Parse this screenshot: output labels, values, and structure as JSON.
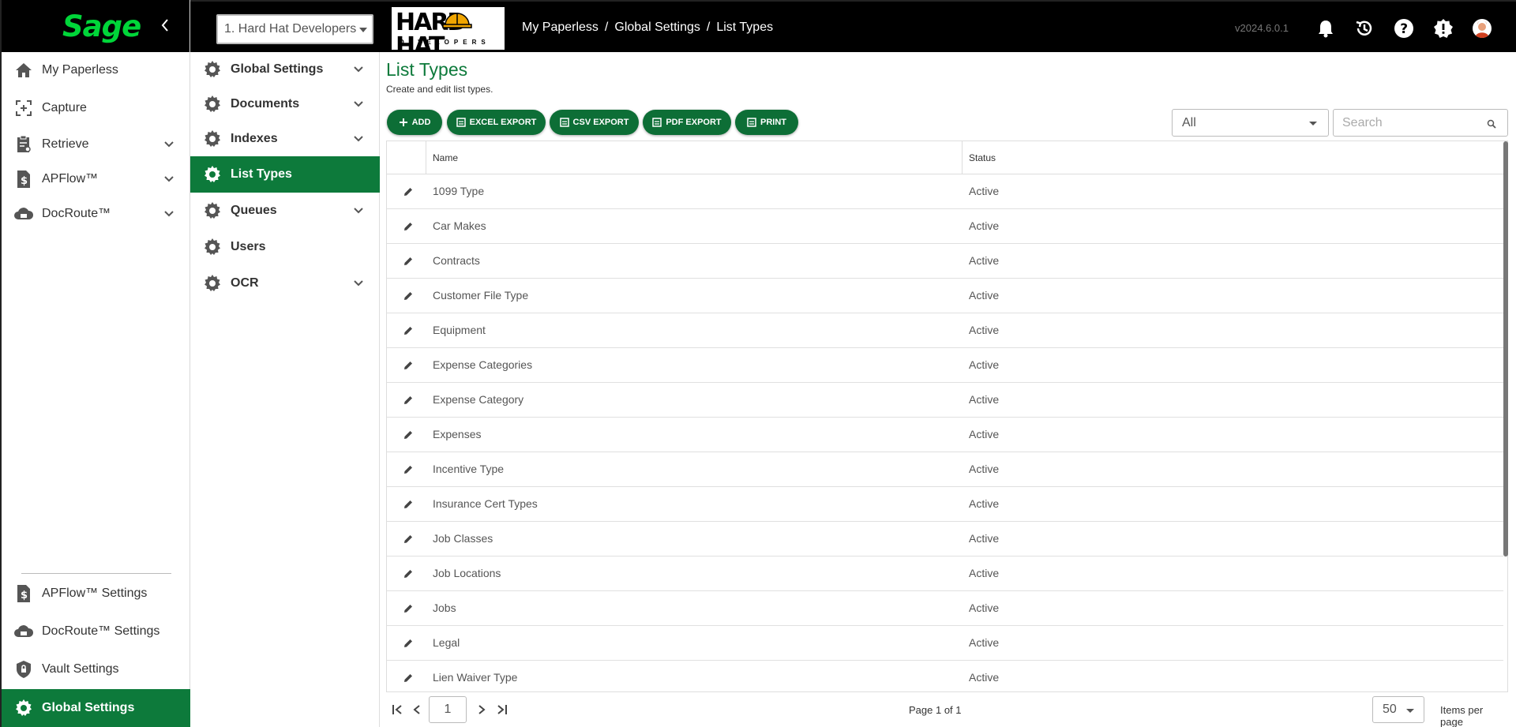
{
  "left_nav": {
    "logo_text": "Sage",
    "items": [
      {
        "label": "My Paperless"
      },
      {
        "label": "Capture"
      },
      {
        "label": "Retrieve"
      },
      {
        "label": "APFlow™"
      },
      {
        "label": "DocRoute™"
      }
    ],
    "bottom_items": [
      {
        "label": "APFlow™ Settings"
      },
      {
        "label": "DocRoute™ Settings"
      },
      {
        "label": "Vault Settings"
      },
      {
        "label": "Global Settings"
      }
    ]
  },
  "top_bar": {
    "company": "1. Hard Hat Developers",
    "logo_text": "HARD HAT",
    "logo_subtext": "DEVELOPERS",
    "breadcrumb": [
      "My Paperless",
      "/",
      "Global Settings",
      "/",
      "List Types"
    ],
    "version": "v2024.6.0.1"
  },
  "sub_nav": {
    "items": [
      {
        "label": "Global Settings"
      },
      {
        "label": "Documents"
      },
      {
        "label": "Indexes"
      },
      {
        "label": "List Types"
      },
      {
        "label": "Queues"
      },
      {
        "label": "Users"
      },
      {
        "label": "OCR"
      }
    ]
  },
  "main": {
    "title": "List Types",
    "subtitle": "Create and edit list types.",
    "toolbar": {
      "add": "ADD",
      "excel": "EXCEL EXPORT",
      "csv": "CSV EXPORT",
      "pdf": "PDF EXPORT",
      "print": "PRINT"
    },
    "status_filter": "All",
    "search_placeholder": "Search",
    "columns": {
      "name": "Name",
      "status": "Status"
    },
    "rows": [
      {
        "name": "1099 Type",
        "status": "Active"
      },
      {
        "name": "Car Makes",
        "status": "Active"
      },
      {
        "name": "Contracts",
        "status": "Active"
      },
      {
        "name": "Customer File Type",
        "status": "Active"
      },
      {
        "name": "Equipment",
        "status": "Active"
      },
      {
        "name": "Expense Categories",
        "status": "Active"
      },
      {
        "name": "Expense Category",
        "status": "Active"
      },
      {
        "name": "Expenses",
        "status": "Active"
      },
      {
        "name": "Incentive Type",
        "status": "Active"
      },
      {
        "name": "Insurance Cert Types",
        "status": "Active"
      },
      {
        "name": "Job Classes",
        "status": "Active"
      },
      {
        "name": "Job Locations",
        "status": "Active"
      },
      {
        "name": "Jobs",
        "status": "Active"
      },
      {
        "name": "Legal",
        "status": "Active"
      },
      {
        "name": "Lien Waiver Type",
        "status": "Active"
      }
    ],
    "pager": {
      "page": "1",
      "info": "Page 1 of 1",
      "per_page": "50",
      "per_page_label": "Items per page"
    }
  },
  "colors": {
    "accent": "#0d7a3b",
    "button": "#0d6e36",
    "logo_green": "#00d639",
    "top_bar": "#000000"
  }
}
